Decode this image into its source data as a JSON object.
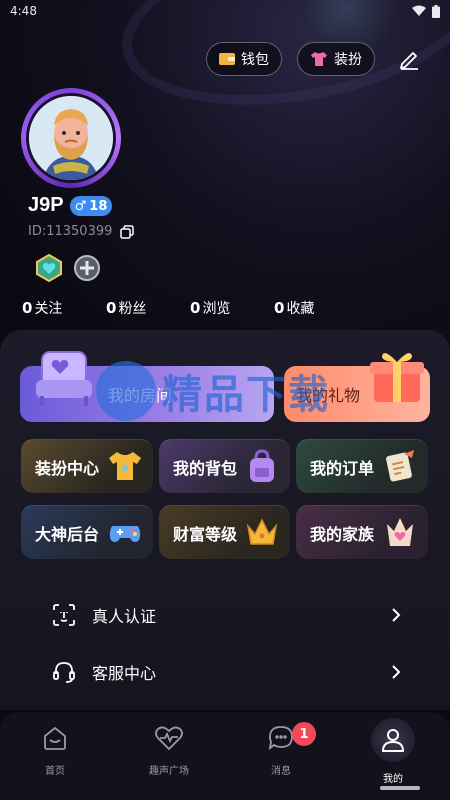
{
  "status_bar": {
    "time": "4:48"
  },
  "header": {
    "wallet_label": "钱包",
    "outfit_label": "装扮"
  },
  "profile": {
    "username": "J9P",
    "gender_symbol": "♂",
    "level": "18",
    "user_id": "ID:11350399"
  },
  "stats": [
    {
      "num": "0",
      "label": "关注"
    },
    {
      "num": "0",
      "label": "粉丝"
    },
    {
      "num": "0",
      "label": "浏览"
    },
    {
      "num": "0",
      "label": "收藏"
    }
  ],
  "cards": {
    "my_room": "我的房间",
    "my_gifts": "我的礼物"
  },
  "tiles": {
    "outfit_center": "装扮中心",
    "my_bag": "我的背包",
    "my_orders": "我的订单",
    "master_backend": "大神后台",
    "wealth_level": "财富等级",
    "my_family": "我的家族"
  },
  "list": {
    "verify": "真人认证",
    "service": "客服中心"
  },
  "watermark": {
    "text": "精品下载"
  },
  "tabbar": {
    "home": "首页",
    "square": "趣声广场",
    "messages": "消息",
    "messages_badge": "1",
    "me": "我的"
  },
  "colors": {
    "background": "#0b0a14",
    "panel": "#1c1b29",
    "gender_badge": "#3d8cf0",
    "avatar_ring": "#9b5cf0",
    "room_card": "#8a70e0",
    "gift_card": "#ff9a80",
    "message_badge": "#f04a5a"
  }
}
